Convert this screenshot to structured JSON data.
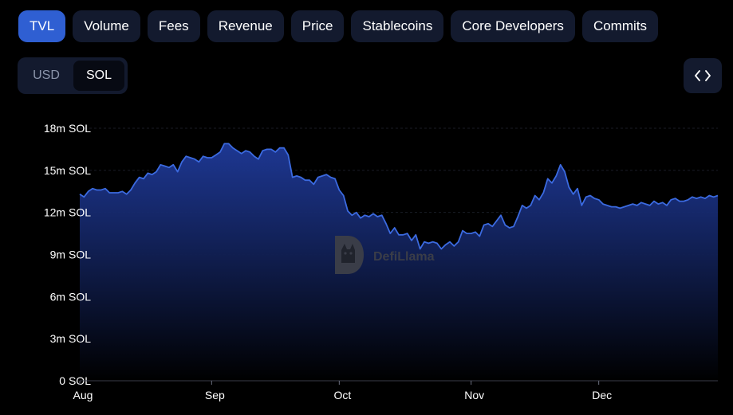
{
  "tabs": [
    {
      "label": "TVL",
      "active": true
    },
    {
      "label": "Volume",
      "active": false
    },
    {
      "label": "Fees",
      "active": false
    },
    {
      "label": "Revenue",
      "active": false
    },
    {
      "label": "Price",
      "active": false
    },
    {
      "label": "Stablecoins",
      "active": false
    },
    {
      "label": "Core Developers",
      "active": false
    },
    {
      "label": "Commits",
      "active": false
    }
  ],
  "denomination": {
    "options": [
      "USD",
      "SOL"
    ],
    "selected": "SOL"
  },
  "embed_icon": "code-brackets-icon",
  "watermark": {
    "text": "DefiLlama",
    "icon": "llama-logo-icon"
  },
  "colors": {
    "active_tab": "#2f5fd2",
    "tab_bg": "#131a2e",
    "line": "#3b6ae0",
    "area_top": "#1f3a9a",
    "area_bottom": "#000000"
  },
  "chart_data": {
    "type": "area",
    "title": "",
    "xlabel": "",
    "ylabel": "",
    "ylim": [
      0,
      18
    ],
    "y_unit": "m SOL",
    "y_ticks": [
      "0 SOL",
      "3m SOL",
      "6m SOL",
      "9m SOL",
      "12m SOL",
      "15m SOL",
      "18m SOL"
    ],
    "x_ticks": [
      {
        "label": "Aug",
        "day": 0
      },
      {
        "label": "Sep",
        "day": 31
      },
      {
        "label": "Oct",
        "day": 61
      },
      {
        "label": "Nov",
        "day": 92
      },
      {
        "label": "Dec",
        "day": 122
      }
    ],
    "grid": true,
    "legend": "none",
    "series": [
      {
        "x": [
          0,
          1,
          2,
          3,
          4,
          5,
          6,
          7,
          8,
          9,
          10,
          11,
          12,
          13,
          14,
          15,
          16,
          17,
          18,
          19,
          20,
          21,
          22,
          23,
          24,
          25,
          26,
          27,
          28,
          29,
          30,
          31,
          32,
          33,
          34,
          35,
          36,
          37,
          38,
          39,
          40,
          41,
          42,
          43,
          44,
          45,
          46,
          47,
          48,
          49,
          50,
          51,
          52,
          53,
          54,
          55,
          56,
          57,
          58,
          59,
          60,
          61,
          62,
          63,
          64,
          65,
          66,
          67,
          68,
          69,
          70,
          71,
          72,
          73,
          74,
          75,
          76,
          77,
          78,
          79,
          80,
          81,
          82,
          83,
          84,
          85,
          86,
          87,
          88,
          89,
          90,
          91,
          92,
          93,
          94,
          95,
          96,
          97,
          98,
          99,
          100,
          101,
          102,
          103,
          104,
          105,
          106,
          107,
          108,
          109,
          110,
          111,
          112,
          113,
          114,
          115,
          116,
          117,
          118,
          119,
          120,
          121,
          122,
          123,
          124,
          125,
          126,
          127,
          128,
          129,
          130,
          131,
          132,
          133,
          134,
          135,
          136,
          137,
          138,
          139,
          140,
          141,
          142,
          143,
          144,
          145,
          146,
          147,
          148,
          149,
          150
        ],
        "values": [
          13.3,
          13.1,
          13.5,
          13.7,
          13.6,
          13.6,
          13.7,
          13.4,
          13.4,
          13.4,
          13.5,
          13.3,
          13.6,
          14.1,
          14.5,
          14.4,
          14.8,
          14.7,
          14.9,
          15.4,
          15.3,
          15.2,
          15.4,
          14.9,
          15.6,
          16.0,
          15.9,
          15.8,
          15.6,
          16.0,
          15.9,
          15.9,
          16.1,
          16.3,
          16.9,
          16.9,
          16.6,
          16.4,
          16.2,
          16.4,
          16.3,
          16.0,
          15.8,
          16.4,
          16.5,
          16.5,
          16.3,
          16.6,
          16.6,
          16.1,
          14.5,
          14.6,
          14.5,
          14.3,
          14.3,
          14.0,
          14.5,
          14.6,
          14.7,
          14.5,
          14.4,
          13.6,
          13.2,
          12.1,
          11.8,
          12.0,
          11.6,
          11.8,
          11.7,
          11.9,
          11.7,
          11.8,
          11.2,
          10.5,
          10.9,
          10.4,
          10.4,
          10.5,
          10.0,
          10.4,
          9.4,
          9.9,
          9.8,
          9.9,
          9.8,
          9.4,
          9.7,
          9.9,
          9.6,
          9.9,
          10.7,
          10.5,
          10.5,
          10.6,
          10.3,
          11.1,
          11.2,
          11.0,
          11.4,
          11.8,
          11.1,
          10.9,
          11.0,
          11.7,
          12.5,
          12.3,
          12.5,
          13.2,
          12.9,
          13.4,
          14.4,
          14.1,
          14.6,
          15.4,
          14.9,
          13.8,
          13.3,
          13.7,
          12.5,
          13.1,
          13.2,
          13.0,
          12.9,
          12.6,
          12.5,
          12.4,
          12.4,
          12.3,
          12.4,
          12.5,
          12.6,
          12.5,
          12.7,
          12.6,
          12.5,
          12.8,
          12.6,
          12.7,
          12.5,
          12.9,
          13.0,
          12.8,
          12.8,
          12.9,
          13.1,
          13.0,
          13.1,
          13.0,
          13.2,
          13.1,
          13.2
        ]
      }
    ]
  }
}
